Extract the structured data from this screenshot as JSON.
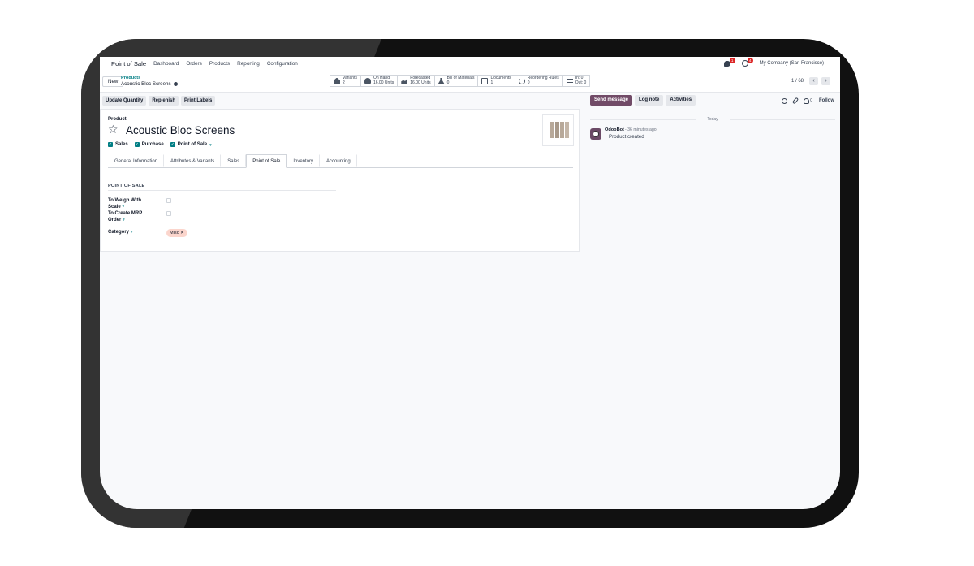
{
  "nav": {
    "app_name": "Point of Sale",
    "items": [
      "Dashboard",
      "Orders",
      "Products",
      "Reporting",
      "Configuration"
    ],
    "messages_badge": "1",
    "activities_badge": "4",
    "company": "My Company (San Francisco)"
  },
  "control": {
    "new_label": "New",
    "breadcrumb_parent": "Products",
    "breadcrumb_current": "Acoustic Bloc Screens",
    "smart_buttons": [
      {
        "icon": "cubes-icon",
        "line1": "Variants",
        "line2": "2"
      },
      {
        "icon": "hand-icon",
        "line1": "On Hand",
        "line2": "16.00 Units"
      },
      {
        "icon": "chart-icon",
        "line1": "Forecasted",
        "line2": "16.00 Units"
      },
      {
        "icon": "flask-icon",
        "line1": "Bill of Materials",
        "line2": "0"
      },
      {
        "icon": "document-icon",
        "line1": "Documents",
        "line2": "1"
      },
      {
        "icon": "refresh-icon",
        "line1": "Reordering Rules",
        "line2": "0"
      },
      {
        "icon": "exchange-icon",
        "line1": "In: 0",
        "line2": "Out: 0"
      }
    ],
    "pager": "1 / 68",
    "pager_prev": "‹",
    "pager_next": "›"
  },
  "actions": [
    "Update Quantity",
    "Replenish",
    "Print Labels"
  ],
  "form": {
    "product_label": "Product",
    "star": "☆",
    "name": "Acoustic Bloc Screens",
    "checks": [
      {
        "label": "Sales",
        "help": ""
      },
      {
        "label": "Purchase",
        "help": ""
      },
      {
        "label": "Point of Sale",
        "help": "?"
      }
    ],
    "tabs": [
      "General Information",
      "Attributes & Variants",
      "Sales",
      "Point of Sale",
      "Inventory",
      "Accounting"
    ],
    "active_tab": "Point of Sale",
    "section_title": "POINT OF SALE",
    "fields": {
      "weigh_label": "To Weigh With Scale",
      "weigh_help": "?",
      "mrp_label": "To Create MRP Order",
      "mrp_help": "?",
      "category_label": "Category",
      "category_help": "?",
      "category_tag": "Misc",
      "tag_remove": "✕"
    }
  },
  "chatter": {
    "send_message": "Send message",
    "log_note": "Log note",
    "activities": "Activities",
    "follower_count": "0",
    "follow": "Follow",
    "today": "Today",
    "message": {
      "author": "OdooBot",
      "time": "- 36 minutes ago",
      "body": "Product created"
    }
  },
  "colors": {
    "primary": "#714b67",
    "accent": "#017e84",
    "badge": "#dc2626",
    "tag": "#fbd5cc"
  }
}
